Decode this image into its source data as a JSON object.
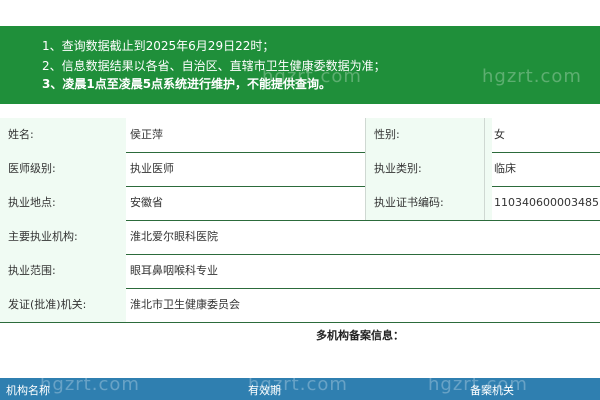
{
  "notice": {
    "line1": "1、查询数据截止到2025年6月29日22时；",
    "line2": "2、信息数据结果以各省、自治区、直辖市卫生健康委数据为准；",
    "line3": "3、凌晨1点至凌晨5点系统进行维护，不能提供查询。"
  },
  "rows": [
    {
      "l1": "姓名:",
      "v1": "侯正萍",
      "l2": "性别:",
      "v2": "女"
    },
    {
      "l1": "医师级别:",
      "v1": "执业医师",
      "l2": "执业类别:",
      "v2": "临床"
    },
    {
      "l1": "执业地点:",
      "v1": "安徽省",
      "l2": "执业证书编码:",
      "v2": "110340600003485"
    },
    {
      "l1": "主要执业机构:",
      "v1": "淮北爱尔眼科医院",
      "l2": "",
      "v2": ""
    },
    {
      "l1": "执业范围:",
      "v1": "眼耳鼻咽喉科专业",
      "l2": "",
      "v2": ""
    },
    {
      "l1": "发证(批准)机关:",
      "v1": "淮北市卫生健康委员会",
      "l2": "",
      "v2": ""
    }
  ],
  "multi_title": "多机构备案信息：",
  "table_headers": [
    "机构名称",
    "有效期",
    "备案机关"
  ],
  "watermark": "hgzrt.com",
  "colors": {
    "notice_bg": "#1f8f3a",
    "header_bg": "#2f7fb0",
    "label_bg": "#f0fbf3"
  }
}
